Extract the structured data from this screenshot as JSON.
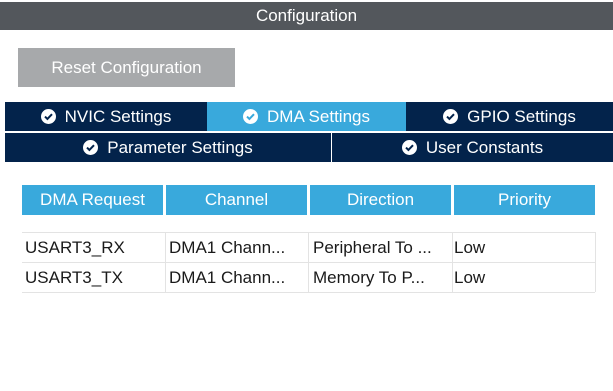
{
  "window": {
    "title": "Configuration"
  },
  "toolbar": {
    "reset_label": "Reset Configuration"
  },
  "tabs": {
    "row1": [
      {
        "label": "NVIC Settings",
        "active": false
      },
      {
        "label": "DMA Settings",
        "active": true
      },
      {
        "label": "GPIO Settings",
        "active": false
      }
    ],
    "row2": [
      {
        "label": "Parameter Settings",
        "active": false
      },
      {
        "label": "User Constants",
        "active": false
      }
    ]
  },
  "dma_table": {
    "columns": [
      "DMA Request",
      "Channel",
      "Direction",
      "Priority"
    ],
    "rows": [
      [
        "USART3_RX",
        "DMA1 Chann...",
        "Peripheral To ...",
        "Low"
      ],
      [
        "USART3_TX",
        "DMA1 Chann...",
        "Memory To P...",
        "Low"
      ]
    ]
  },
  "colors": {
    "title_bar": "#53575c",
    "tab_inactive": "#03234b",
    "tab_active": "#39a9dc",
    "header": "#39a9dc",
    "button": "#a7a9ab"
  },
  "icons": {
    "tab_status": "check-circle-icon"
  }
}
